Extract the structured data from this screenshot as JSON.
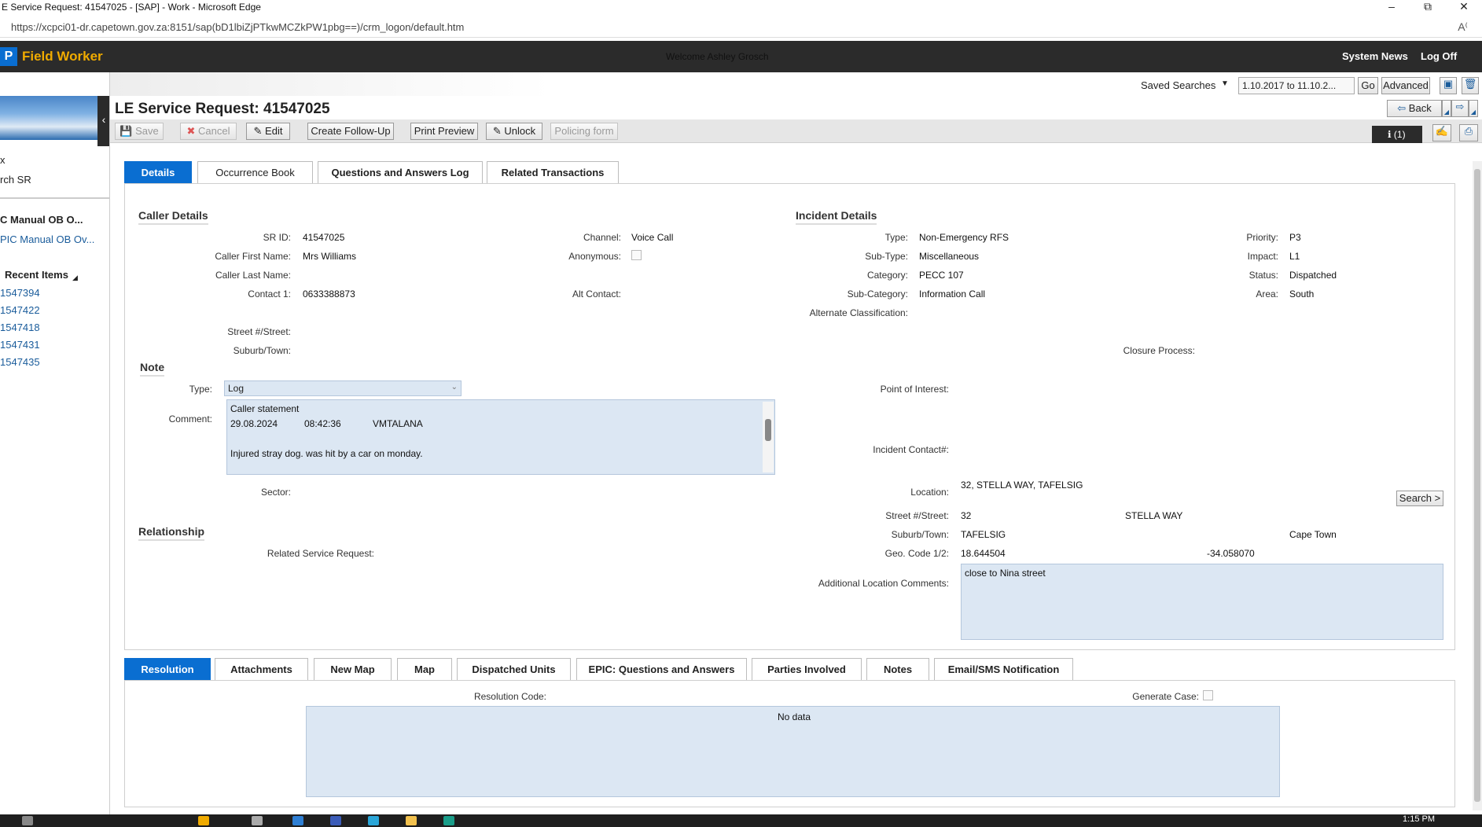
{
  "window": {
    "title": "E Service Request: 41547025 - [SAP] - Work - Microsoft Edge",
    "url": "https://xcpci01-dr.capetown.gov.za:8151/sap(bD1lbiZjPTkwMCZkPW1pbg==)/crm_logon/default.htm"
  },
  "header": {
    "logo": "P",
    "app_name": "Field Worker",
    "welcome": "Welcome Ashley Grosch",
    "system_news": "System News",
    "log_off": "Log Off"
  },
  "saved_search": {
    "label": "Saved Searches",
    "selected": "1.10.2017 to 11.10.2...",
    "go": "Go",
    "advanced": "Advanced"
  },
  "nav": {
    "item1": "x",
    "item2": "rch SR",
    "item3": "C Manual OB O...",
    "item4": "PIC Manual OB Ov...",
    "recent_title": "Recent Items",
    "recent": [
      "1547394",
      "1547422",
      "1547418",
      "1547431",
      "1547435"
    ]
  },
  "page": {
    "title": "LE Service Request: 41547025",
    "back": "Back",
    "info_count": "(1)"
  },
  "toolbar": {
    "save": "Save",
    "cancel": "Cancel",
    "edit": "Edit",
    "follow_up": "Create Follow-Up",
    "print_preview": "Print Preview",
    "unlock": "Unlock",
    "policing_form": "Policing form"
  },
  "tabs": [
    "Details",
    "Occurrence Book",
    "Questions and Answers Log",
    "Related Transactions"
  ],
  "caller": {
    "heading": "Caller Details",
    "sr_id_label": "SR ID:",
    "sr_id": "41547025",
    "first_name_label": "Caller First Name:",
    "first_name": "Mrs Williams",
    "last_name_label": "Caller Last Name:",
    "contact1_label": "Contact 1:",
    "contact1": "0633388873",
    "channel_label": "Channel:",
    "channel": "Voice Call",
    "anonymous_label": "Anonymous:",
    "alt_contact_label": "Alt Contact:",
    "street_label": "Street #/Street:",
    "suburb_label": "Suburb/Town:"
  },
  "note": {
    "heading": "Note",
    "type_label": "Type:",
    "type": "Log",
    "comment_label": "Comment:",
    "line1": "Caller statement",
    "line2_date": "29.08.2024",
    "line2_time": "08:42:36",
    "line2_user": "VMTALANA",
    "line3": "Injured stray dog. was hit by a car on monday.",
    "sector_label": "Sector:"
  },
  "relationship": {
    "heading": "Relationship",
    "related_label": "Related Service Request:"
  },
  "incident": {
    "heading": "Incident Details",
    "type_label": "Type:",
    "type": "Non-Emergency RFS",
    "subtype_label": "Sub-Type:",
    "subtype": "Miscellaneous",
    "category_label": "Category:",
    "category": "PECC 107",
    "subcategory_label": "Sub-Category:",
    "subcategory": "Information Call",
    "alt_class_label": "Alternate Classification:",
    "priority_label": "Priority:",
    "priority": "P3",
    "impact_label": "Impact:",
    "impact": "L1",
    "status_label": "Status:",
    "status": "Dispatched",
    "area_label": "Area:",
    "area": "South",
    "closure_label": "Closure Process:",
    "poi_label": "Point of Interest:",
    "incident_contact_label": "Incident Contact#:",
    "location_label": "Location:",
    "location": "32, STELLA WAY, TAFELSIG",
    "search_btn": "Search >",
    "street_label": "Street #/Street:",
    "street_no": "32",
    "street": "STELLA WAY",
    "suburb_label": "Suburb/Town:",
    "suburb": "TAFELSIG",
    "city": "Cape Town",
    "geo_label": "Geo. Code 1/2:",
    "geo1": "18.644504",
    "geo2": "-34.058070",
    "add_loc_label": "Additional Location Comments:",
    "add_loc": "close to Nina street"
  },
  "bottom_tabs": [
    "Resolution",
    "Attachments",
    "New Map",
    "Map",
    "Dispatched Units",
    "EPIC: Questions and Answers",
    "Parties Involved",
    "Notes",
    "Email/SMS Notification"
  ],
  "resolution": {
    "code_label": "Resolution Code:",
    "generate_case_label": "Generate Case:",
    "no_data": "No data"
  },
  "taskbar": {
    "clock": "1:15 PM"
  },
  "colors": {
    "accent": "#0a6ed1",
    "header_bg": "#2b2b2b",
    "brand_orange": "#f0ab00",
    "field_bg": "#dce7f3"
  }
}
